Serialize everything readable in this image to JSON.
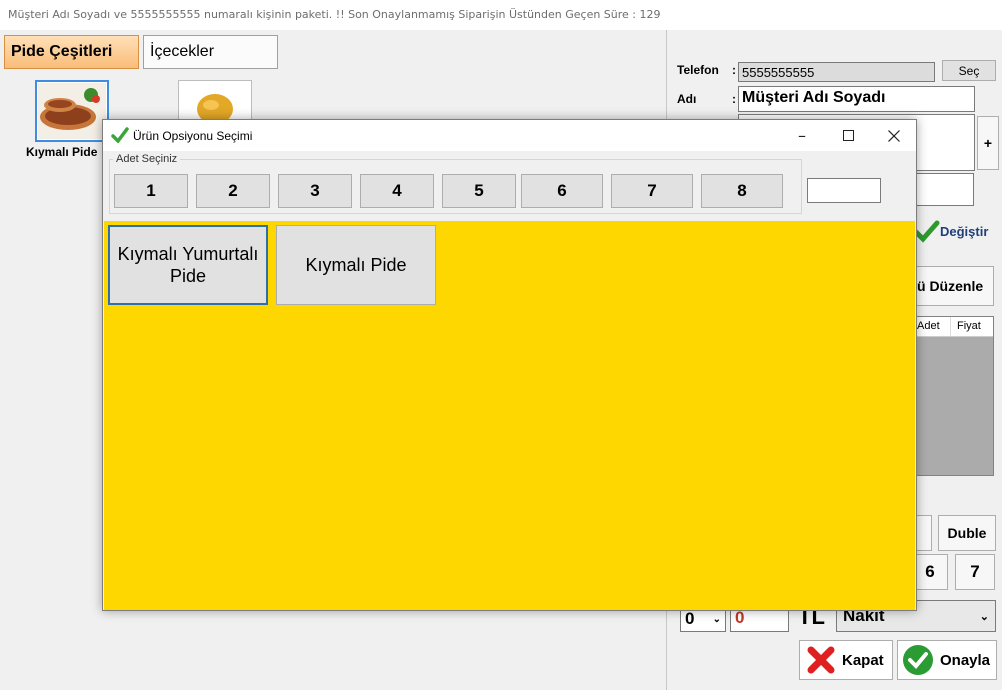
{
  "window": {
    "title": "Müşteri Adı Soyadı ve 5555555555 numaralı kişinin paketi. !! Son Onaylanmamış Siparişin Üstünden Geçen Süre : 129"
  },
  "categories": {
    "tabs": [
      "Pide Çeşitleri",
      "İçecekler"
    ]
  },
  "products": [
    {
      "label": "Kıymalı Pide",
      "icon": "pide-image"
    },
    {
      "label": "",
      "icon": "soup-image"
    }
  ],
  "customer": {
    "phone_label": "Telefon",
    "phone_value": "5555555555",
    "select_button": "Seç",
    "name_label": "Adı",
    "name_value": "Müşteri Adı Soyadı",
    "add_button": "+",
    "change_button": "Değiştir",
    "edit_button": "ü Düzenle"
  },
  "order_table": {
    "columns": [
      "Adet",
      "Fiyat"
    ]
  },
  "keypad": {
    "duble_label": "Duble",
    "keys": [
      "6",
      "7"
    ]
  },
  "payment": {
    "discount_select": "0",
    "amount": "0",
    "currency": "TL",
    "method": "Nakit",
    "close_button": "Kapat",
    "confirm_button": "Onayla"
  },
  "dialog": {
    "title": "Ürün Opsiyonu Seçimi",
    "quantity_group_label": "Adet Seçiniz",
    "quantity_buttons": [
      "1",
      "2",
      "3",
      "4",
      "5",
      "6",
      "7",
      "8"
    ],
    "quantity_input": "",
    "options": [
      "Kıymalı Yumurtalı Pide",
      "Kıymalı Pide"
    ]
  },
  "colors": {
    "accent_yellow": "#ffd700",
    "active_tab": "#f9bd78",
    "selection_blue": "#3d8ee3",
    "amount_red": "#c0392b"
  }
}
